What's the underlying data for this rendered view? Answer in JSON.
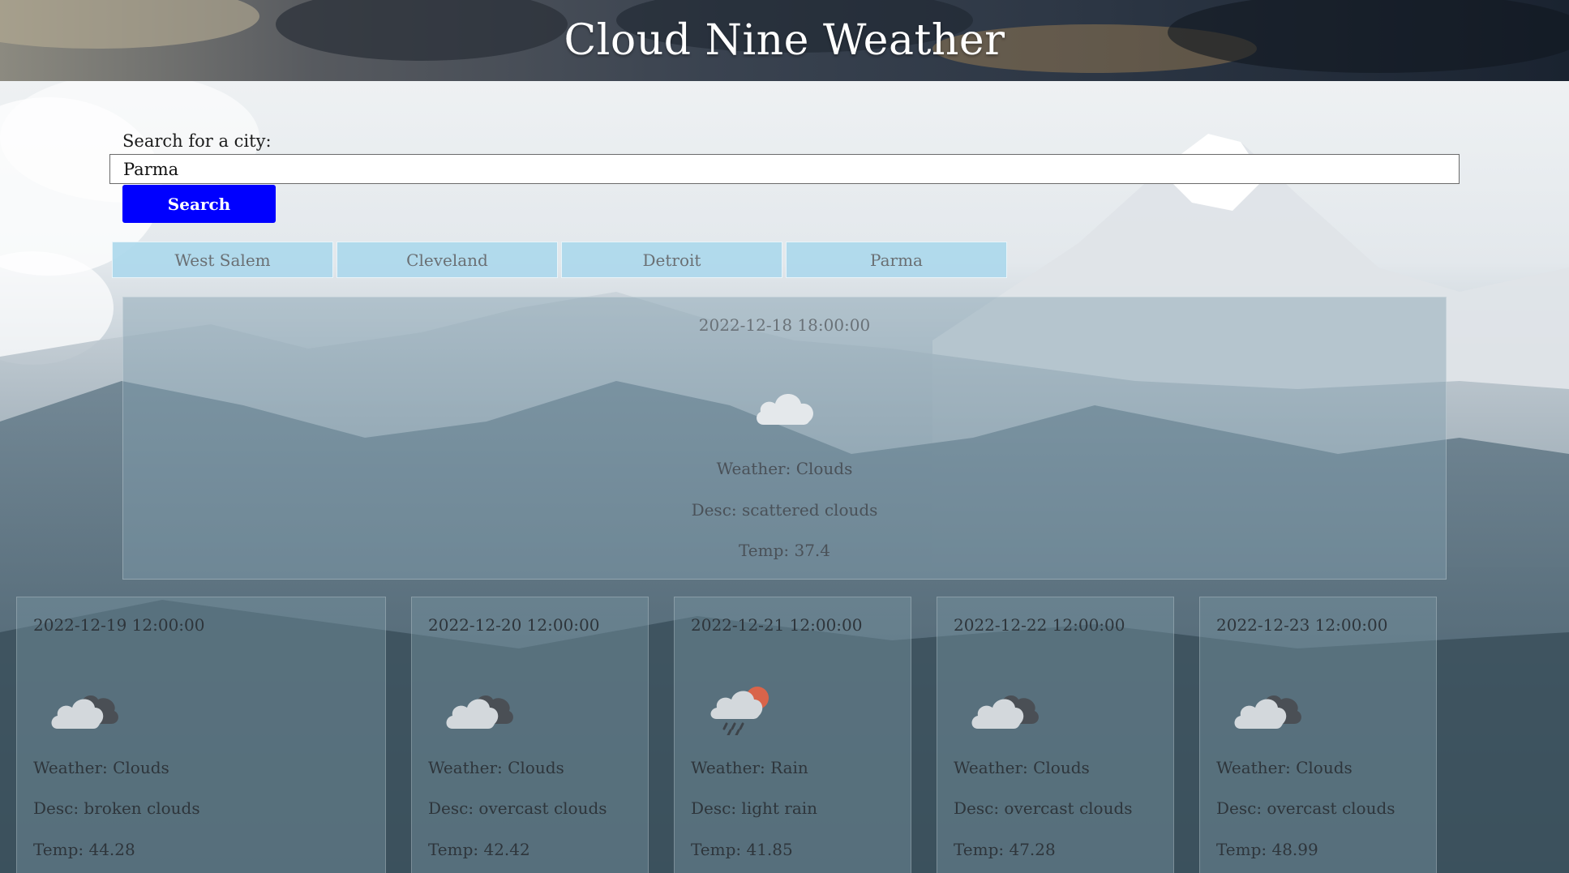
{
  "header": {
    "title": "Cloud Nine Weather"
  },
  "search": {
    "label": "Search for a city:",
    "value": "Parma",
    "button_label": "Search",
    "button_color": "#0000ff"
  },
  "history": [
    "West Salem",
    "Cleveland",
    "Detroit",
    "Parma"
  ],
  "current": {
    "date": "2022-12-18 18:00:00",
    "icon": "cloud-icon",
    "weather": "Weather: Clouds",
    "desc": "Desc: scattered clouds",
    "temp": "Temp: 37.4"
  },
  "forecast": [
    {
      "date": "2022-12-19 12:00:00",
      "icon": "broken-clouds-icon",
      "weather": "Weather: Clouds",
      "desc": "Desc: broken clouds",
      "temp": "Temp: 44.28"
    },
    {
      "date": "2022-12-20 12:00:00",
      "icon": "overcast-clouds-icon",
      "weather": "Weather: Clouds",
      "desc": "Desc: overcast clouds",
      "temp": "Temp: 42.42"
    },
    {
      "date": "2022-12-21 12:00:00",
      "icon": "light-rain-icon",
      "weather": "Weather: Rain",
      "desc": "Desc: light rain",
      "temp": "Temp: 41.85"
    },
    {
      "date": "2022-12-22 12:00:00",
      "icon": "overcast-clouds-icon",
      "weather": "Weather: Clouds",
      "desc": "Desc: overcast clouds",
      "temp": "Temp: 47.28"
    },
    {
      "date": "2022-12-23 12:00:00",
      "icon": "overcast-clouds-icon",
      "weather": "Weather: Clouds",
      "desc": "Desc: overcast clouds",
      "temp": "Temp: 48.99"
    }
  ]
}
